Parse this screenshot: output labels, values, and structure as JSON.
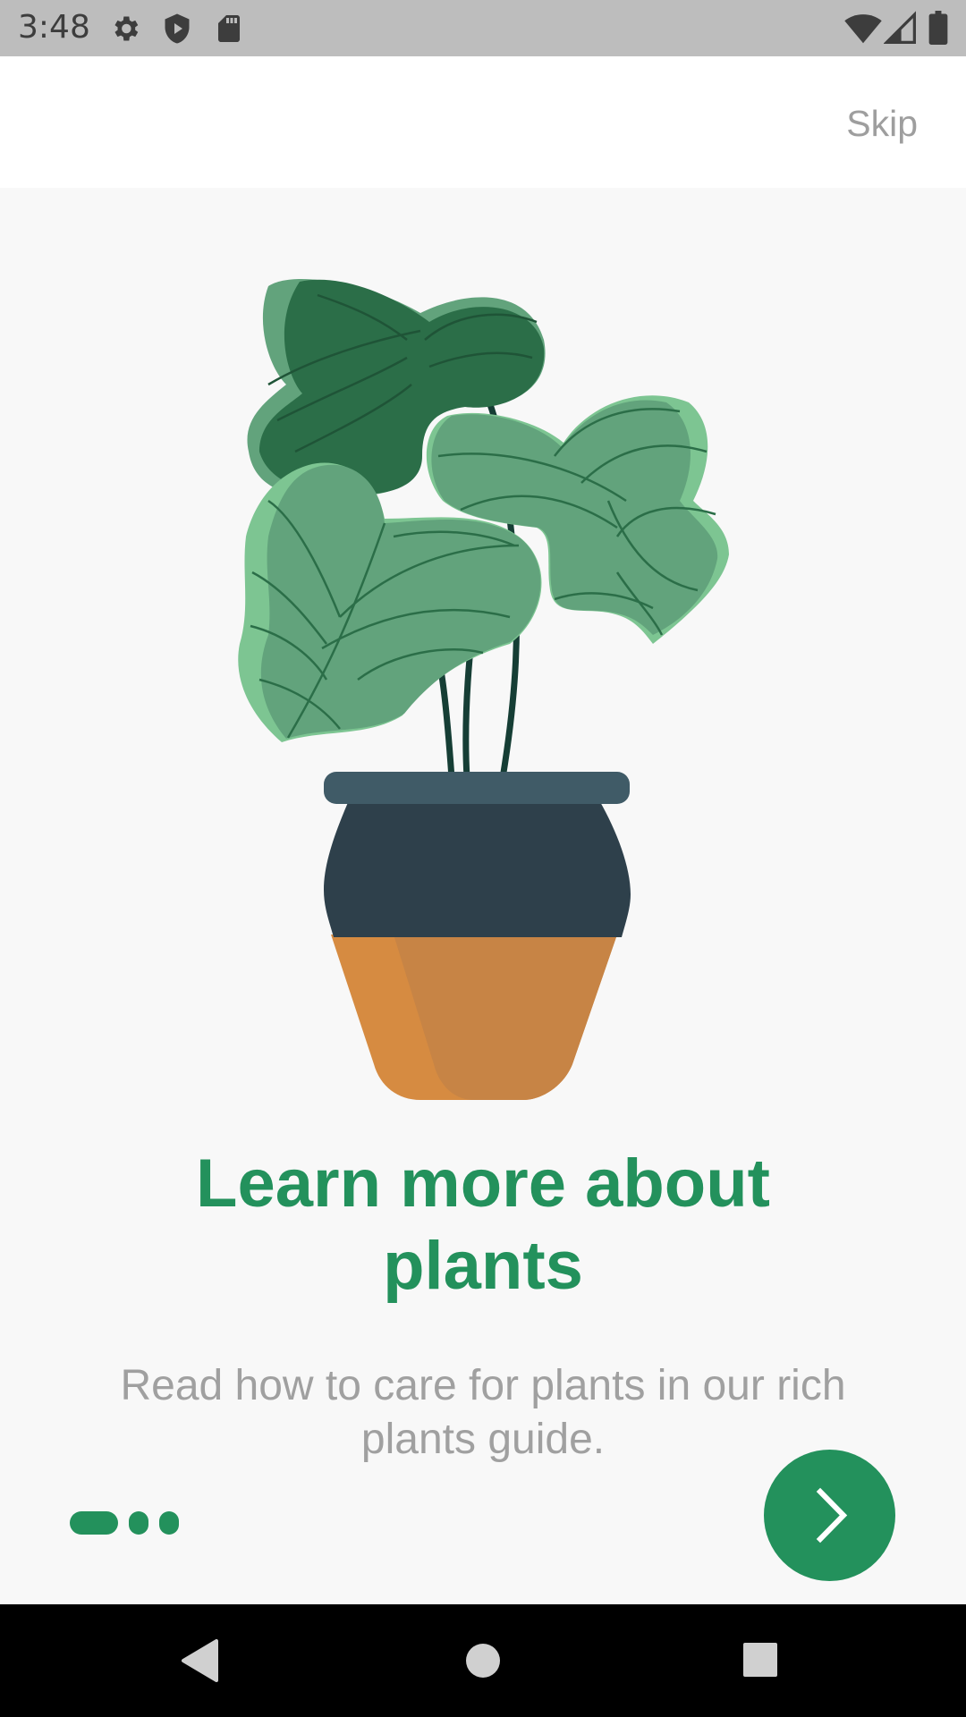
{
  "status_bar": {
    "time": "3:48",
    "icons_left": [
      "settings-icon",
      "shield-play-icon",
      "sd-card-icon"
    ],
    "icons_right": [
      "wifi-icon",
      "cell-signal-icon",
      "battery-icon"
    ]
  },
  "top_bar": {
    "skip_label": "Skip"
  },
  "onboarding": {
    "illustration": "potted-plant-illustration",
    "title": "Learn more about plants",
    "subtitle": "Read how to care for plants in our rich plants guide.",
    "page_indicator": {
      "total": 3,
      "current": 1
    },
    "next_icon": "chevron-right-icon"
  },
  "nav_bar": {
    "icons": [
      "back-icon",
      "home-icon",
      "recents-icon"
    ]
  },
  "colors": {
    "accent": "#23915c",
    "skip_text": "#9e9e9e",
    "subtitle_text": "#a0a0a0",
    "background": "#f8f8f8",
    "status_bar": "#bdbdbd",
    "pot_dark": "#2e404b",
    "pot_rim": "#405b67",
    "pot_clay": "#d68b41",
    "leaf_dark": "#2b6e48",
    "leaf_mid": "#62a37c",
    "leaf_light": "#7dc592"
  }
}
